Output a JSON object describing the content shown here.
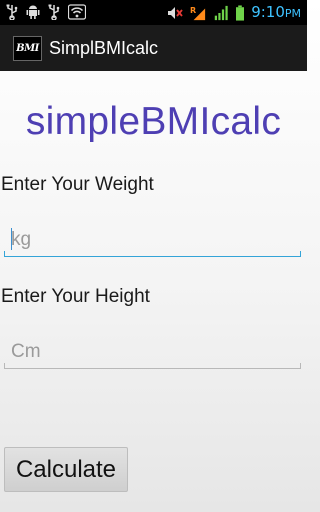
{
  "status_bar": {
    "time": "9:10",
    "time_suffix": "PM",
    "icons": [
      "usb-icon",
      "android-debug-icon",
      "usb-icon",
      "wifi-icon",
      "mute-icon",
      "roaming-signal-icon",
      "signal-icon",
      "battery-icon"
    ],
    "accent_color": "#3ec2ff"
  },
  "action_bar": {
    "app_icon_text": "BMI",
    "title": "SimplBMIcalc"
  },
  "main": {
    "heading": "simpleBMIcalc",
    "heading_color": "#4e3fb3",
    "weight": {
      "label": "Enter Your Weight",
      "placeholder": "kg",
      "value": ""
    },
    "height": {
      "label": "Enter Your Height",
      "placeholder": "Cm",
      "value": ""
    },
    "calculate_label": "Calculate"
  }
}
